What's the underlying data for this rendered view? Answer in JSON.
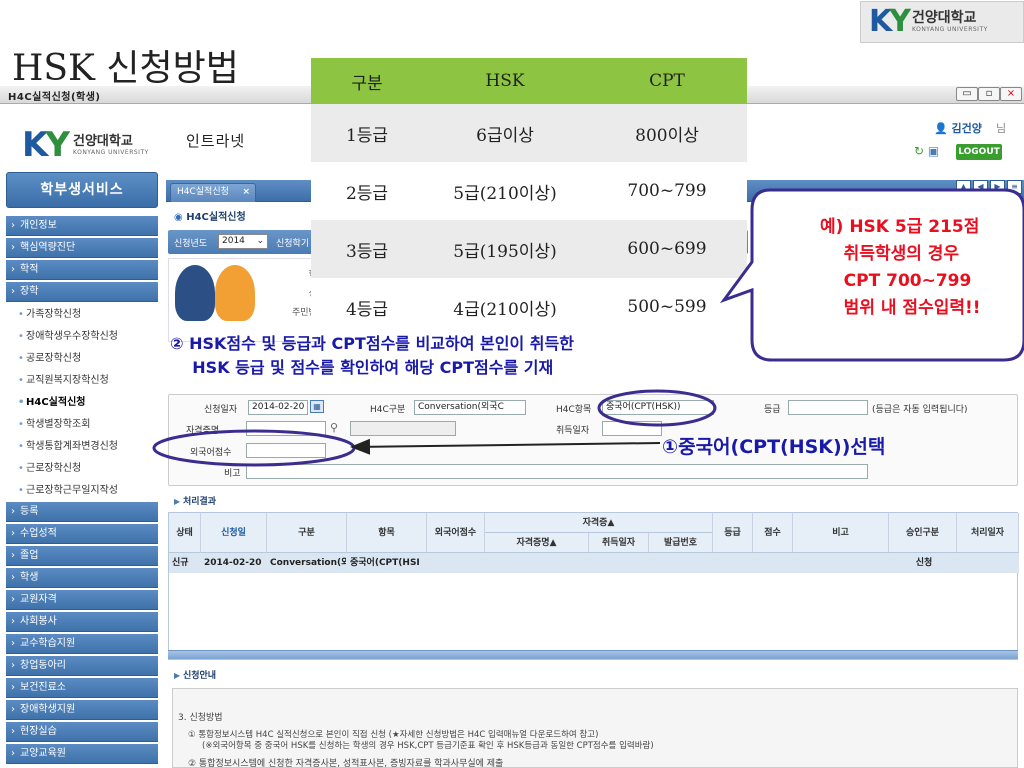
{
  "slide": {
    "title": "HSK 신청방법"
  },
  "logo": {
    "name": "건양대학교",
    "sub": "KONYANG UNIVERSITY",
    "mark_left": "K",
    "mark_right": "Y"
  },
  "window": {
    "title": "H4C실적신청(학생)",
    "buttons": [
      "▭",
      "▫",
      "×"
    ]
  },
  "header": {
    "logo_name": "건양대학교",
    "logo_sub": "KONYANG UNIVERSITY",
    "intranet": "인트라넷",
    "user": "김건양",
    "user_suffix": "님",
    "logout": "LOGOUT"
  },
  "sidebar": {
    "title": "학부생서비스",
    "menu": [
      "개인정보",
      "핵심역량진단",
      "학적",
      "장학"
    ],
    "scholarship_sub": [
      "가족장학신청",
      "장애학생우수장학신청",
      "공로장학신청",
      "교직원복지장학신청",
      "H4C실적신청",
      "학생별장학조회",
      "학생통합계좌변경신청",
      "근로장학신청",
      "근로장학근무일지작성"
    ],
    "menu_after": [
      "등록",
      "수업성적",
      "졸업",
      "학생",
      "교원자격",
      "사회봉사",
      "교수학습지원",
      "창업동아리",
      "보건진료소",
      "장애학생지원",
      "현장실습",
      "교양교육원"
    ]
  },
  "tab": {
    "label": "H4C실적신청",
    "close": "×"
  },
  "page": {
    "title": "H4C실적신청"
  },
  "filter": {
    "year_label": "신청년도",
    "year_value": "2014",
    "apply_cut": "신청학기"
  },
  "student_panel": {
    "labels": [
      "학번",
      "성명",
      "주민번호"
    ]
  },
  "form": {
    "date_label": "신청일자",
    "date_value": "2014-02-20",
    "h4c_type_label": "H4C구분",
    "h4c_type_value": "Conversation(외국C",
    "h4c_item_label": "H4C항목",
    "h4c_item_value": "중국어(CPT(HSK))",
    "grade_label": "등급",
    "grade_note": "(등급은 자동 입력됩니다)",
    "cert_label": "자격증명",
    "acq_date_label": "취득일자",
    "score_label": "외국어점수",
    "note_label": "비고"
  },
  "results": {
    "section_title": "처리결과",
    "headers": [
      "상태",
      "신청일",
      "구분",
      "항목",
      "외국어점수",
      "자격증▲",
      "등급",
      "점수",
      "비고",
      "승인구분",
      "처리일자"
    ],
    "sub_headers": [
      "자격증명▲",
      "취득일자",
      "발급번호"
    ],
    "row": {
      "status": "신규",
      "date": "2014-02-20",
      "type": "Conversation(외",
      "item": "중국어(CPT(HSI",
      "approval": "신청"
    }
  },
  "info": {
    "section_title": "신청안내",
    "lines": [
      "3. 신청방법",
      "① 통합정보시스템 H4C 실적신청으로 본인이 직접 신청 (★자세한 신청방법은 H4C 입력매뉴얼 다운로드하여 참고)",
      "(※외국어항목 중 중국어 HSK를 신청하는 학생의 경우 HSK,CPT 등급기준표 확인 후 HSK등급과 동일한 CPT점수를 입력바람)",
      "② 통합정보시스템에 신청한 자격증사본, 성적표사본, 증빙자료를 학과사무실에 제출"
    ]
  },
  "hsk_table": {
    "headers": [
      "구분",
      "HSK",
      "CPT"
    ],
    "rows": [
      [
        "1등급",
        "6급이상",
        "800이상"
      ],
      [
        "2등급",
        "5급(210이상)",
        "700~799"
      ],
      [
        "3등급",
        "5급(195이상)",
        "600~699"
      ],
      [
        "4등급",
        "4급(210이상)",
        "500~599"
      ]
    ]
  },
  "callout": {
    "text": "예) HSK 5급 215점\n    취득학생의 경우\n    CPT 700~799\n    범위 내 점수입력!!"
  },
  "annotations": {
    "note2": "② HSK점수 및 등급과 CPT점수를 비교하여 본인이 취득한\n    HSK 등급 및 점수를 확인하여 해당 CPT점수를 기재",
    "note1": "①중국어(CPT(HSK))선택"
  },
  "colors": {
    "table_header": "#8dc442",
    "annotation_blue": "#1a1aa8",
    "callout_red": "#e81020",
    "menu_blue": "#4a7bb4"
  }
}
